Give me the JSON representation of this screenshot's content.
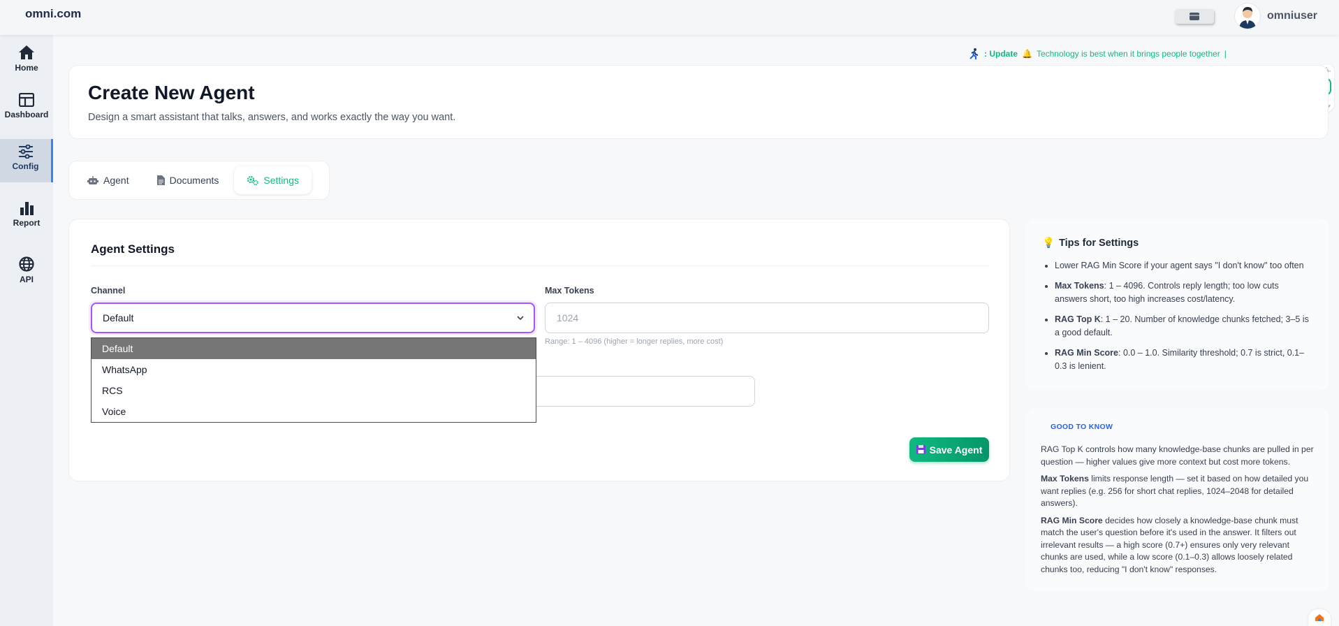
{
  "app": {
    "brand": "omni.com",
    "username": "omniuser"
  },
  "sidebar": {
    "items": [
      {
        "label": "Home",
        "icon": "home-icon"
      },
      {
        "label": "Dashboard",
        "icon": "dashboard-icon"
      },
      {
        "label": "Config",
        "icon": "sliders-icon",
        "active": true
      },
      {
        "label": "Report",
        "icon": "bar-chart-icon"
      },
      {
        "label": "API",
        "icon": "globe-icon"
      }
    ]
  },
  "ticker": {
    "prefix": ": Update",
    "message": "Technology is best when it brings people together"
  },
  "header": {
    "title": "Create New Agent",
    "subtitle": "Design a smart assistant that talks, answers, and works exactly the way you want."
  },
  "tabs": [
    {
      "label": "Agent",
      "icon": "robot-icon"
    },
    {
      "label": "Documents",
      "icon": "document-icon"
    },
    {
      "label": "Settings",
      "icon": "gears-icon",
      "active": true
    }
  ],
  "settings": {
    "title": "Agent Settings",
    "channel": {
      "label": "Channel",
      "value": "Default",
      "options": [
        "Default",
        "WhatsApp",
        "RCS",
        "Voice"
      ]
    },
    "max_tokens": {
      "label": "Max Tokens",
      "placeholder": "1024",
      "hint": "Range: 1 – 4096 (higher = longer replies, more cost)"
    },
    "save_label": "Save Agent"
  },
  "tips": {
    "title": "Tips for Settings",
    "items": [
      {
        "bold": "",
        "text": "Lower RAG Min Score if your agent says \"I don't know\" too often"
      },
      {
        "bold": "Max Tokens",
        "text": ": 1 – 4096. Controls reply length; too low cuts answers short, too high increases cost/latency."
      },
      {
        "bold": "RAG Top K",
        "text": ": 1 – 20. Number of knowledge chunks fetched; 3–5 is a good default."
      },
      {
        "bold": "RAG Min Score",
        "text": ": 0.0 – 1.0. Similarity threshold; 0.7 is strict, 0.1–0.3 is lenient."
      }
    ]
  },
  "good_to_know": {
    "title": "GOOD TO KNOW",
    "paragraphs": [
      {
        "bold": "",
        "text": "RAG Top K controls how many knowledge-base chunks are pulled in per question — higher values give more context but cost more tokens."
      },
      {
        "bold": "Max Tokens",
        "text": " limits response length — set it based on how detailed you want replies (e.g. 256 for short chat replies, 1024–2048 for detailed answers)."
      },
      {
        "bold": "RAG Min Score",
        "text": " decides how closely a knowledge-base chunk must match the user's question before it's used in the answer. It filters out irrelevant results — a high score (0.7+) ensures only very relevant chunks are used, while a low score (0.1–0.3) allows loosely related chunks too, reducing \"I don't know\" responses."
      }
    ]
  },
  "colors": {
    "accent": "#10b981",
    "focus": "#a855f7",
    "link": "#2563eb",
    "active_nav": "#3b82f6"
  }
}
